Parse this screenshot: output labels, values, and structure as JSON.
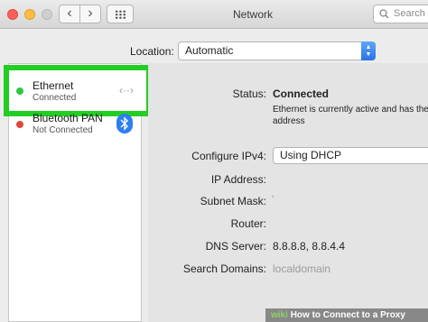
{
  "window": {
    "title": "Network",
    "search_placeholder": "Search"
  },
  "toolbar": {
    "back_glyph": "‹",
    "forward_glyph": "›"
  },
  "location": {
    "label": "Location:",
    "value": "Automatic"
  },
  "services": [
    {
      "name": "Ethernet",
      "status": "Connected",
      "status_color": "#2bc840",
      "icon": "ethernet-arrows-icon",
      "icon_glyph": "‹··›"
    },
    {
      "name": "Bluetooth PAN",
      "status": "Not Connected",
      "status_color": "#e0453c",
      "icon": "bluetooth-icon"
    }
  ],
  "details": {
    "status_label": "Status:",
    "status_value": "Connected",
    "status_note": "Ethernet is currently active and has the address",
    "configure_label": "Configure IPv4:",
    "configure_value": "Using DHCP",
    "ip_label": "IP Address:",
    "subnet_label": "Subnet Mask:",
    "subnet_value": "'",
    "router_label": "Router:",
    "dns_label": "DNS Server:",
    "dns_value": "8.8.8.8, 8.8.4.4",
    "search_domains_label": "Search Domains:",
    "search_domains_value": "localdomain"
  },
  "watermark": {
    "brand": "wiki",
    "text": "How to Connect to a Proxy Server"
  },
  "colors": {
    "highlight": "#22ce22",
    "accent": "#2c7ef1"
  }
}
